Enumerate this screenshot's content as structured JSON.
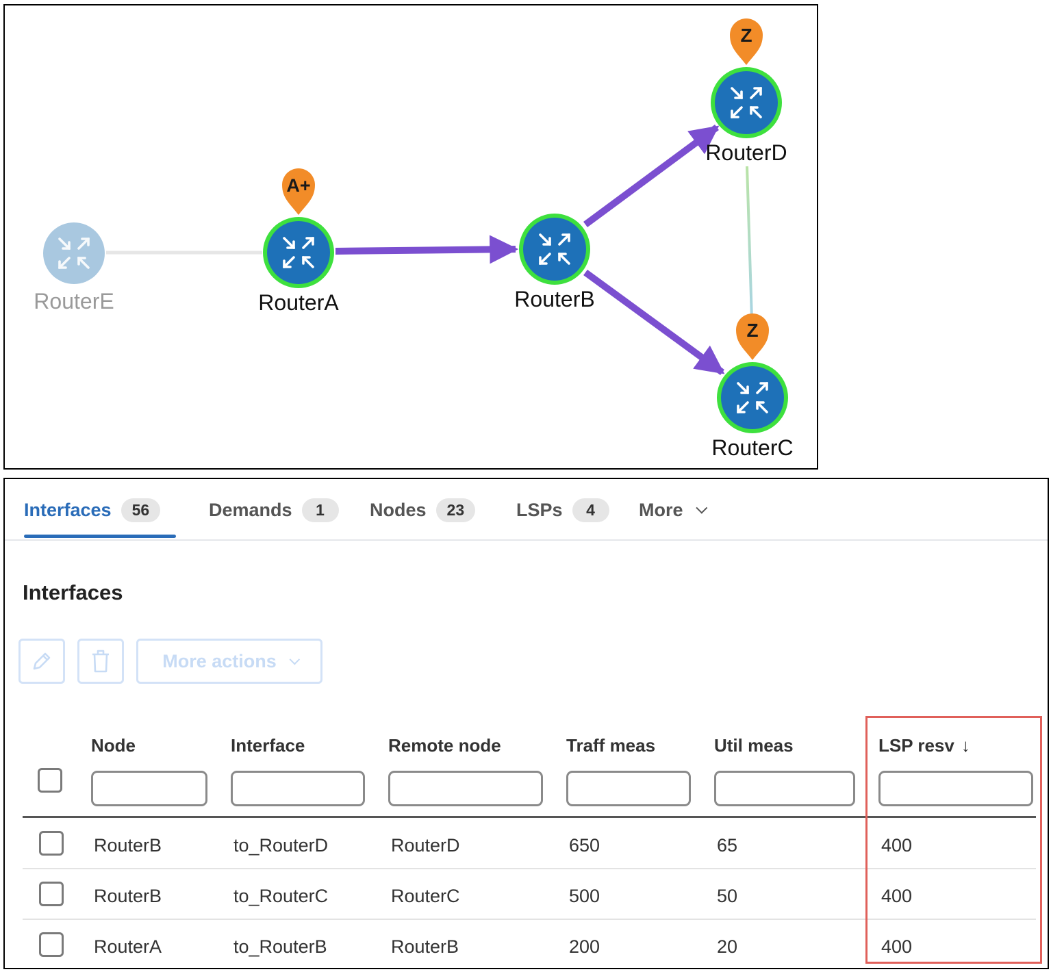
{
  "topology": {
    "nodes": [
      {
        "id": "RouterE",
        "label": "RouterE",
        "state": "faded"
      },
      {
        "id": "RouterA",
        "label": "RouterA",
        "state": "selected",
        "marker": "A+"
      },
      {
        "id": "RouterB",
        "label": "RouterB",
        "state": "selected"
      },
      {
        "id": "RouterD",
        "label": "RouterD",
        "state": "selected",
        "marker": "Z"
      },
      {
        "id": "RouterC",
        "label": "RouterC",
        "state": "selected",
        "marker": "Z"
      }
    ],
    "links": [
      {
        "from": "RouterE",
        "to": "RouterA",
        "style": "faded"
      },
      {
        "from": "RouterA",
        "to": "RouterB",
        "style": "lsp-path"
      },
      {
        "from": "RouterB",
        "to": "RouterD",
        "style": "lsp-path"
      },
      {
        "from": "RouterB",
        "to": "RouterC",
        "style": "lsp-path"
      },
      {
        "from": "RouterD",
        "to": "RouterC",
        "style": "plain"
      }
    ],
    "colors": {
      "path": "#7b4fd0",
      "node": "#1e71b8",
      "ring": "#3ee03e",
      "marker": "#f28c28",
      "faded": "#a9c8e0"
    },
    "icon": "router-arrows-icon"
  },
  "tabs": [
    {
      "label": "Interfaces",
      "count": "56",
      "active": true
    },
    {
      "label": "Demands",
      "count": "1"
    },
    {
      "label": "Nodes",
      "count": "23"
    },
    {
      "label": "LSPs",
      "count": "4"
    },
    {
      "label": "More"
    }
  ],
  "section_title": "Interfaces",
  "toolbar": {
    "edit_icon": "pencil-icon",
    "delete_icon": "trash-icon",
    "more_actions": "More actions"
  },
  "table": {
    "columns": [
      "Node",
      "Interface",
      "Remote node",
      "Traff meas",
      "Util meas",
      "LSP resv"
    ],
    "sorted_column": "LSP resv",
    "sort_direction": "descending",
    "rows": [
      [
        "RouterB",
        "to_RouterD",
        "RouterD",
        "650",
        "65",
        "400"
      ],
      [
        "RouterB",
        "to_RouterC",
        "RouterC",
        "500",
        "50",
        "400"
      ],
      [
        "RouterA",
        "to_RouterB",
        "RouterB",
        "200",
        "20",
        "400"
      ]
    ]
  }
}
